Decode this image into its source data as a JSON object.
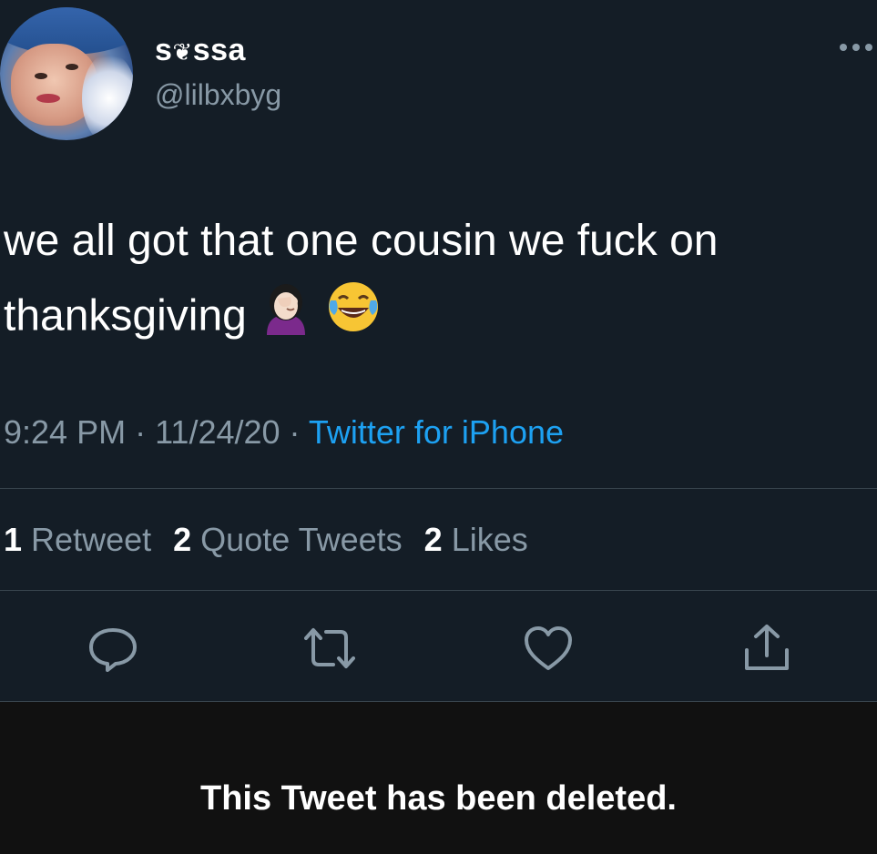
{
  "user": {
    "display_name_prefix": "s",
    "display_name_symbol": "❦",
    "display_name_suffix": "ssa",
    "handle": "@lilbxbyg",
    "more_icon": "more-dots-icon"
  },
  "tweet": {
    "line1": "we all got that one cousin we fuck on",
    "line2": "thanksgiving",
    "emojis": [
      "woman-facepalming-emoji",
      "face-with-tears-of-joy-emoji"
    ]
  },
  "meta": {
    "time": "9:24 PM",
    "sep1": " · ",
    "date": "11/24/20",
    "sep2": " · ",
    "source": "Twitter for iPhone"
  },
  "stats": {
    "retweets_count": "1",
    "retweets_label": "Retweet",
    "quotes_count": "2",
    "quotes_label": "Quote Tweets",
    "likes_count": "2",
    "likes_label": "Likes"
  },
  "actions": {
    "icons": [
      "reply-icon",
      "retweet-icon",
      "like-icon",
      "share-icon"
    ],
    "color": "#8899a6"
  },
  "banner": {
    "text": "This Tweet has been deleted."
  },
  "colors": {
    "background": "#141d26",
    "accent": "#1da1f2",
    "secondary_text": "#8899a6",
    "divider": "#38444d",
    "banner_bg": "#111111"
  }
}
